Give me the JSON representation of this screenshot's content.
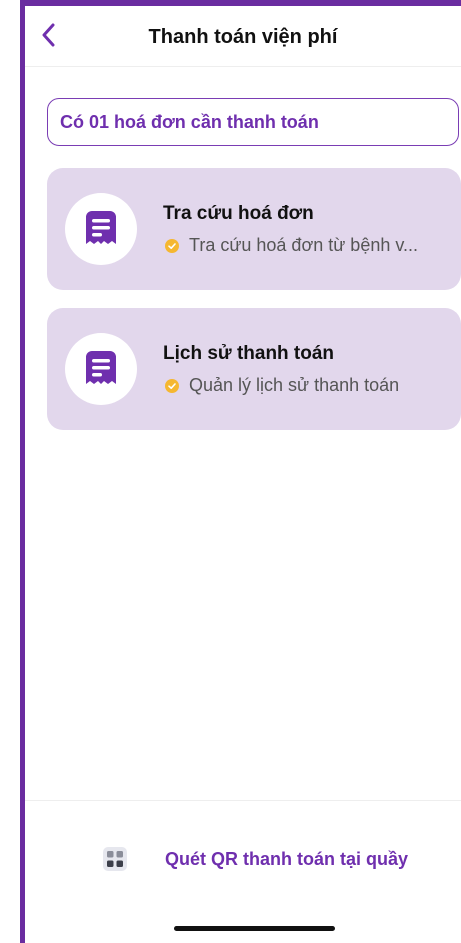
{
  "header": {
    "title": "Thanh toán viện phí",
    "back_icon": "chevron-left-icon"
  },
  "notice": {
    "text": "Có 01 hoá đơn cần thanh toán"
  },
  "menu": [
    {
      "title": "Tra cứu hoá đơn",
      "subtitle": "Tra cứu hoá đơn từ bệnh v...",
      "icon": "receipt-icon",
      "badge_icon": "check-badge-icon"
    },
    {
      "title": "Lịch sử thanh toán",
      "subtitle": "Quản lý lịch sử thanh toán",
      "icon": "receipt-icon",
      "badge_icon": "check-badge-icon"
    }
  ],
  "footer": {
    "qr_label": "Quét QR thanh toán tại quầy",
    "qr_icon": "qr-code-icon"
  },
  "colors": {
    "brand": "#6f2fae",
    "card_bg": "#e2d7ec",
    "badge": "#f5b731"
  }
}
